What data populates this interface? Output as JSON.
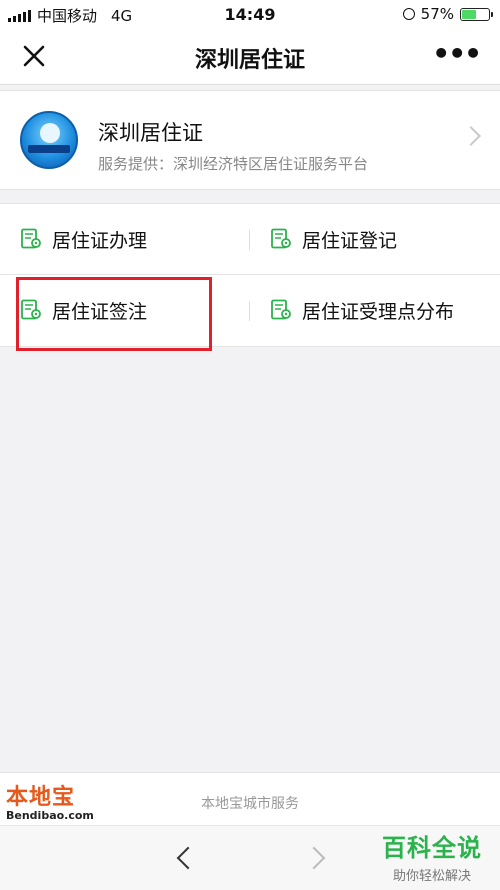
{
  "status": {
    "carrier": "中国移动",
    "network": "4G",
    "time": "14:49",
    "battery": "57%",
    "battery_level": 0.57
  },
  "navbar": {
    "title": "深圳居住证",
    "close_icon": "close-icon",
    "more_icon": "more-icon"
  },
  "card": {
    "name": "深圳居住证",
    "provider": "服务提供：深圳经济特区居住证服务平台",
    "logo_text": "深圳居住证"
  },
  "menu": {
    "items": [
      {
        "label": "居住证办理",
        "icon": "document-location-icon"
      },
      {
        "label": "居住证登记",
        "icon": "document-location-icon"
      },
      {
        "label": "居住证签注",
        "icon": "document-location-icon"
      },
      {
        "label": "居住证受理点分布",
        "icon": "document-location-icon"
      }
    ]
  },
  "footer": {
    "brand": "本地宝",
    "brand_url": "Bendibao.com",
    "service": "本地宝城市服务"
  },
  "watermark": {
    "title": "百科全说",
    "subtitle": "助你轻松解决"
  },
  "colors": {
    "accent": "#2bb24c",
    "highlight": "#e0202a",
    "brand": "#e55a1c"
  }
}
